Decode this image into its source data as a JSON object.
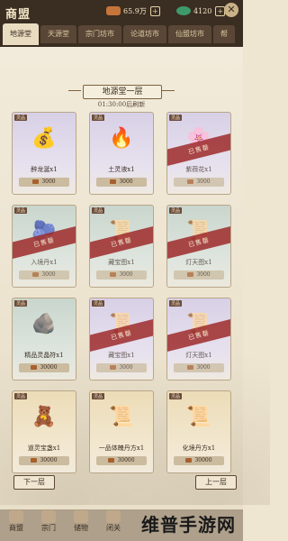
{
  "header": {
    "title": "商盟",
    "copper": "65.9万",
    "jade": "4120",
    "tabs": [
      "地源堂",
      "天源堂",
      "宗门坊市",
      "论道坊市",
      "仙盟坊市",
      "帮"
    ]
  },
  "floor": {
    "title": "地源堂一层",
    "refresh": "01:30:00后刷新"
  },
  "cards": [
    {
      "tag": "灵品",
      "icon": "sack-icon",
      "glyph": "💰",
      "name": "醉龙涎x1",
      "price": "3000",
      "rarity": "purple",
      "sold": false
    },
    {
      "tag": "灵品",
      "icon": "fire-icon",
      "glyph": "🔥",
      "name": "土灵液x1",
      "price": "3000",
      "rarity": "purple",
      "sold": false
    },
    {
      "tag": "灵品",
      "icon": "flower-icon",
      "glyph": "🌸",
      "name": "紫薇花x1",
      "price": "3000",
      "rarity": "purple",
      "sold": true
    },
    {
      "tag": "灵品",
      "icon": "pill-icon",
      "glyph": "🫐",
      "name": "入境丹x1",
      "price": "3000",
      "rarity": "green",
      "sold": true
    },
    {
      "tag": "灵品",
      "icon": "map-icon",
      "glyph": "📜",
      "name": "藏宝图x1",
      "price": "3000",
      "rarity": "green",
      "sold": true
    },
    {
      "tag": "灵品",
      "icon": "map-icon",
      "glyph": "📜",
      "name": "灯天图x1",
      "price": "3000",
      "rarity": "green",
      "sold": true
    },
    {
      "tag": "灵品",
      "icon": "crystal-icon",
      "glyph": "🪨",
      "name": "精品灵晶符x1",
      "price": "30000",
      "rarity": "green",
      "sold": false
    },
    {
      "tag": "灵品",
      "icon": "map-icon",
      "glyph": "📜",
      "name": "藏宝图x1",
      "price": "3000",
      "rarity": "purple",
      "sold": true
    },
    {
      "tag": "灵品",
      "icon": "map-icon",
      "glyph": "📜",
      "name": "灯天图x1",
      "price": "3000",
      "rarity": "purple",
      "sold": true
    },
    {
      "tag": "灵品",
      "icon": "puppet-icon",
      "glyph": "🧸",
      "name": "道灵宝盏x1",
      "price": "30000",
      "rarity": "gold",
      "sold": false
    },
    {
      "tag": "灵品",
      "icon": "scroll-icon",
      "glyph": "📜",
      "name": "一品体魄丹方x1",
      "price": "30000",
      "rarity": "gold",
      "sold": false
    },
    {
      "tag": "灵品",
      "icon": "scroll-icon",
      "glyph": "📜",
      "name": "化境丹方x1",
      "price": "30000",
      "rarity": "gold",
      "sold": false
    }
  ],
  "sold_label": "已售罄",
  "buttons": {
    "prev": "下一层",
    "next": "上一层"
  },
  "bottom_nav": [
    "商盟",
    "宗门",
    "储物",
    "闭关"
  ],
  "watermark": "维普手游网"
}
